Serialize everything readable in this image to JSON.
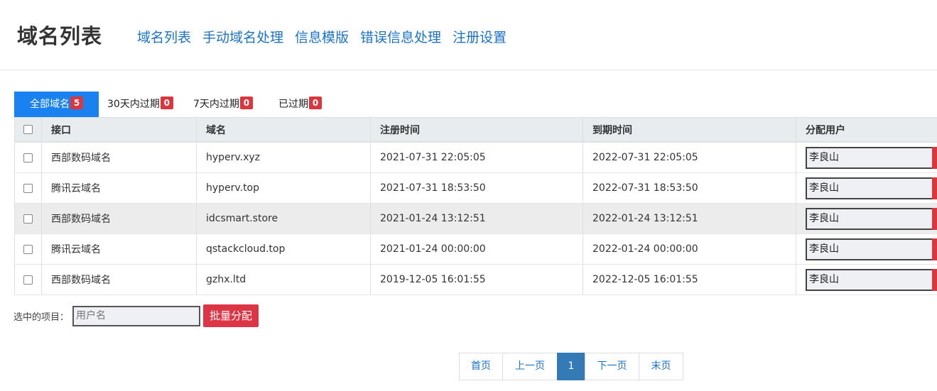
{
  "header": {
    "title": "域名列表",
    "nav": [
      "域名列表",
      "手动域名处理",
      "信息模版",
      "错误信息处理",
      "注册设置"
    ]
  },
  "tabs": [
    {
      "label": "全部域名",
      "count": "5"
    },
    {
      "label": "30天内过期",
      "count": "0"
    },
    {
      "label": "7天内过期",
      "count": "0"
    },
    {
      "label": "已过期",
      "count": "0"
    }
  ],
  "table": {
    "columns": [
      "接口",
      "域名",
      "注册时间",
      "到期时间",
      "分配用户"
    ],
    "rows": [
      {
        "interface": "西部数码域名",
        "domain": "hyperv.xyz",
        "registered": "2021-07-31 22:05:05",
        "expires": "2022-07-31 22:05:05",
        "user": "李良山"
      },
      {
        "interface": "腾讯云域名",
        "domain": "hyperv.top",
        "registered": "2021-07-31 18:53:50",
        "expires": "2022-07-31 18:53:50",
        "user": "李良山"
      },
      {
        "interface": "西部数码域名",
        "domain": "idcsmart.store",
        "registered": "2021-01-24 13:12:51",
        "expires": "2022-01-24 13:12:51",
        "user": "李良山"
      },
      {
        "interface": "腾讯云域名",
        "domain": "qstackcloud.top",
        "registered": "2021-01-24 00:00:00",
        "expires": "2022-01-24 00:00:00",
        "user": "李良山"
      },
      {
        "interface": "西部数码域名",
        "domain": "gzhx.ltd",
        "registered": "2019-12-05 16:01:55",
        "expires": "2022-12-05 16:01:55",
        "user": "李良山"
      }
    ]
  },
  "bulk": {
    "label": "选中的项目：",
    "placeholder": "用户名",
    "button": "批量分配"
  },
  "pagination": {
    "first": "首页",
    "prev": "上一页",
    "current": "1",
    "next": "下一页",
    "last": "末页"
  },
  "colors": {
    "accent": "#1a82f0",
    "link": "#1a73c9",
    "danger": "#dc3545",
    "pager_active": "#337ab7"
  }
}
